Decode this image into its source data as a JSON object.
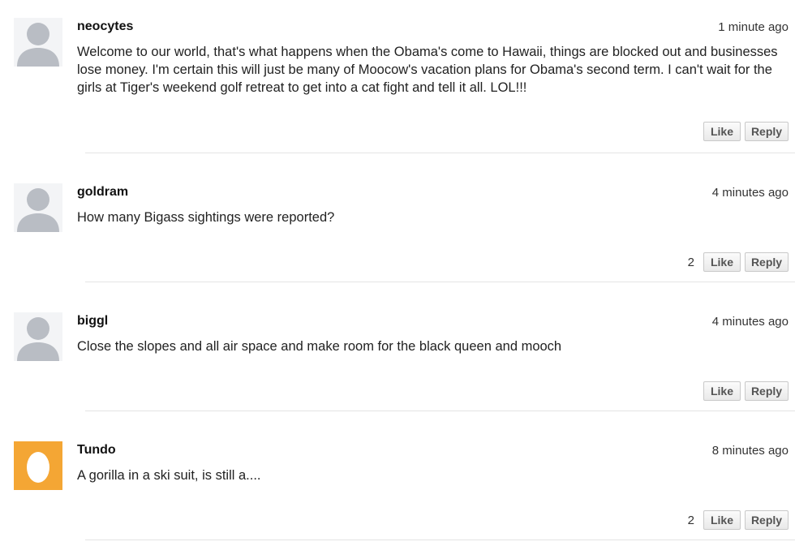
{
  "comments": [
    {
      "author": "neocytes",
      "time": "1 minute ago",
      "text": "Welcome to our world, that's what happens when the Obama's come to Hawaii, things are blocked out and businesses lose money.  I'm certain this will just be many of Moocow's vacation plans for Obama's second term.  I can't wait for the girls at Tiger's weekend golf retreat to get into a cat fight and tell it all.  LOL!!!",
      "like_count": "",
      "avatar": "default-person-icon"
    },
    {
      "author": "goldram",
      "time": "4 minutes ago",
      "text": "How many Bigass sightings were reported?",
      "like_count": "2",
      "avatar": "default-person-icon"
    },
    {
      "author": "biggl",
      "time": "4 minutes ago",
      "text": "Close the slopes and all air space and make room for the black queen and mooch",
      "like_count": "",
      "avatar": "default-person-icon"
    },
    {
      "author": "Tundo",
      "time": "8 minutes ago",
      "text": "A gorilla in a ski suit, is still a....",
      "like_count": "2",
      "avatar": "egg-icon"
    }
  ],
  "buttons": {
    "like": "Like",
    "reply": "Reply"
  },
  "colors": {
    "default_avatar_bg": "#c8cbd0",
    "default_avatar_figure": "#eef0f2",
    "egg_avatar_bg": "#f4a634",
    "egg_color": "#ffffff"
  }
}
